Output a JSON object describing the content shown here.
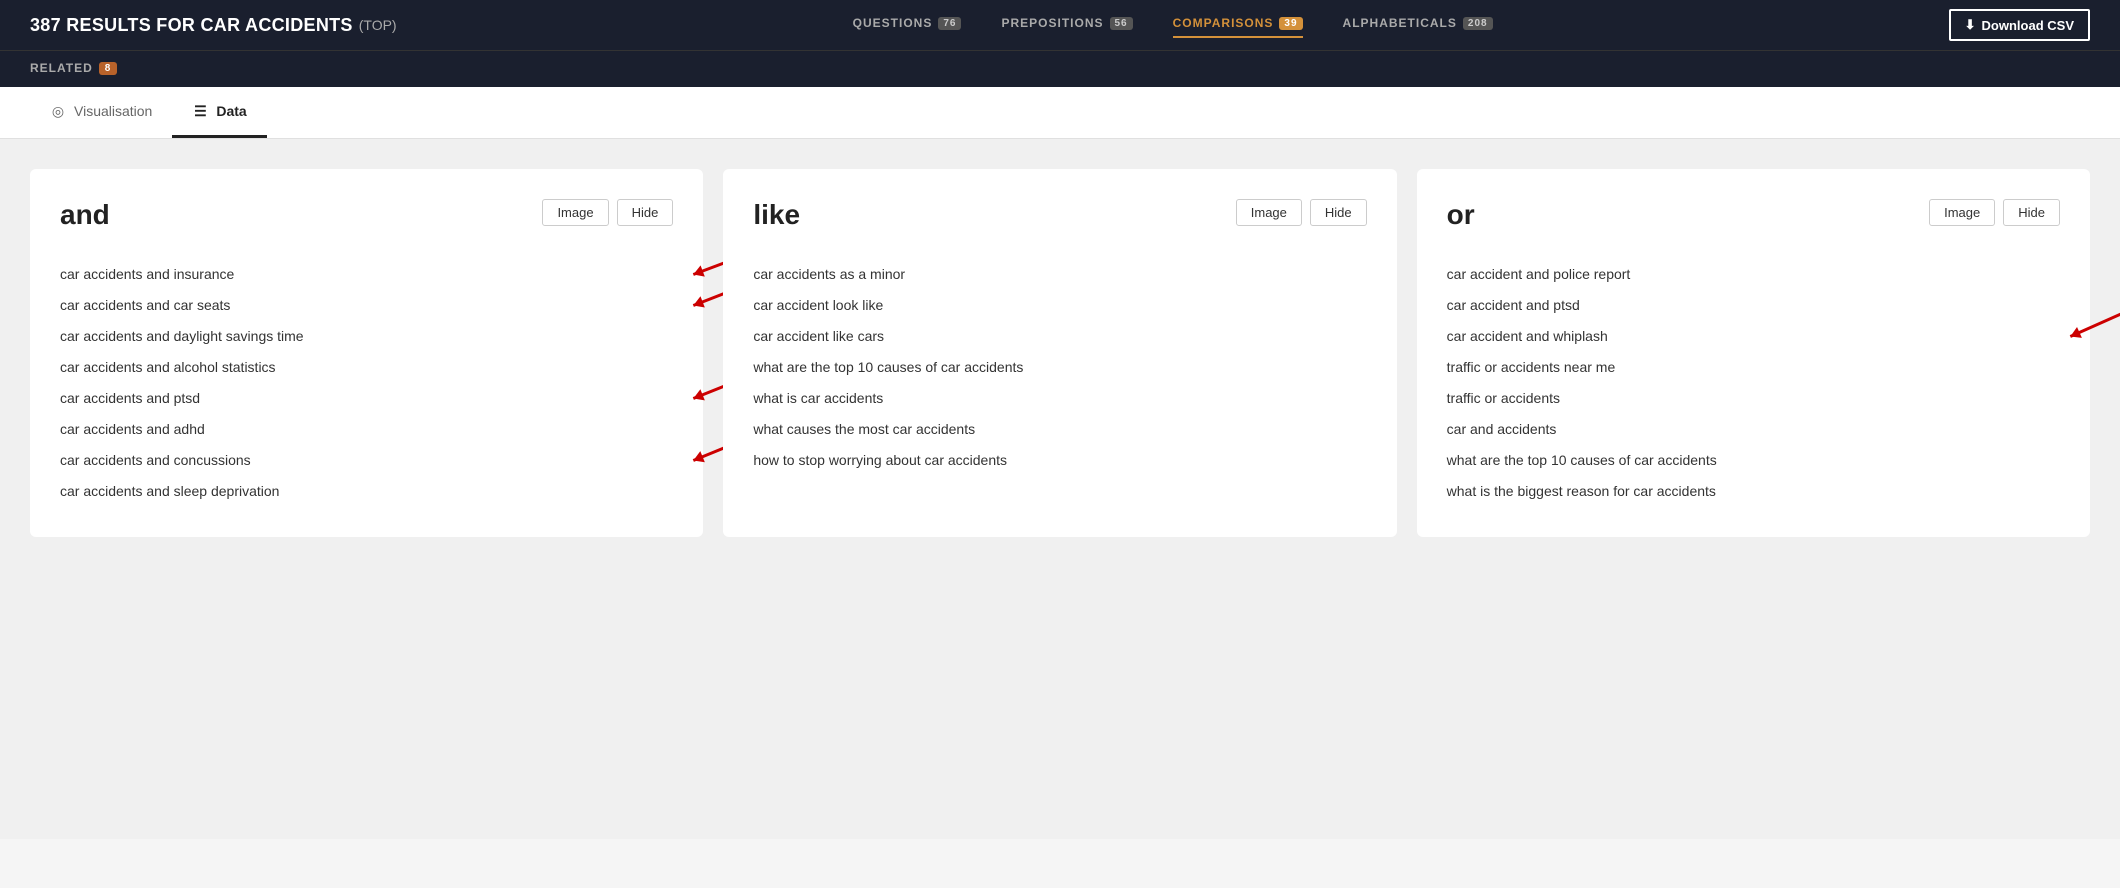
{
  "header": {
    "title": "387 RESULTS FOR CAR ACCIDENTS",
    "subtitle": "(TOP)",
    "download_label": "Download CSV",
    "tabs": [
      {
        "id": "questions",
        "label": "QUESTIONS",
        "count": "76",
        "active": false
      },
      {
        "id": "prepositions",
        "label": "PREPOSITIONS",
        "count": "56",
        "active": false
      },
      {
        "id": "comparisons",
        "label": "COMPARISONS",
        "count": "39",
        "active": true
      },
      {
        "id": "alphabeticals",
        "label": "ALPHABETICALS",
        "count": "208",
        "active": false
      }
    ]
  },
  "sub_header": {
    "related_label": "RELATED",
    "related_count": "8"
  },
  "view_tabs": [
    {
      "id": "visualisation",
      "label": "Visualisation",
      "active": false
    },
    {
      "id": "data",
      "label": "Data",
      "active": true
    }
  ],
  "cards": [
    {
      "id": "and",
      "title": "and",
      "image_label": "Image",
      "hide_label": "Hide",
      "items": [
        "car accidents and insurance",
        "car accidents and car seats",
        "car accidents and daylight savings time",
        "car accidents and alcohol statistics",
        "car accidents and ptsd",
        "car accidents and adhd",
        "car accidents and concussions",
        "car accidents and sleep deprivation"
      ]
    },
    {
      "id": "like",
      "title": "like",
      "image_label": "Image",
      "hide_label": "Hide",
      "items": [
        "car accidents as a minor",
        "car accident look like",
        "car accident like cars",
        "what are the top 10 causes of car accidents",
        "what is car accidents",
        "what causes the most car accidents",
        "how to stop worrying about car accidents"
      ]
    },
    {
      "id": "or",
      "title": "or",
      "image_label": "Image",
      "hide_label": "Hide",
      "items": [
        "car accident and police report",
        "car accident and ptsd",
        "car accident and whiplash",
        "traffic or accidents near me",
        "traffic or accidents",
        "car and accidents",
        "what are the top 10 causes of car accidents",
        "what is the biggest reason for car accidents"
      ]
    }
  ],
  "icons": {
    "download": "⬇",
    "visualisation": "◎",
    "data": "☰"
  }
}
